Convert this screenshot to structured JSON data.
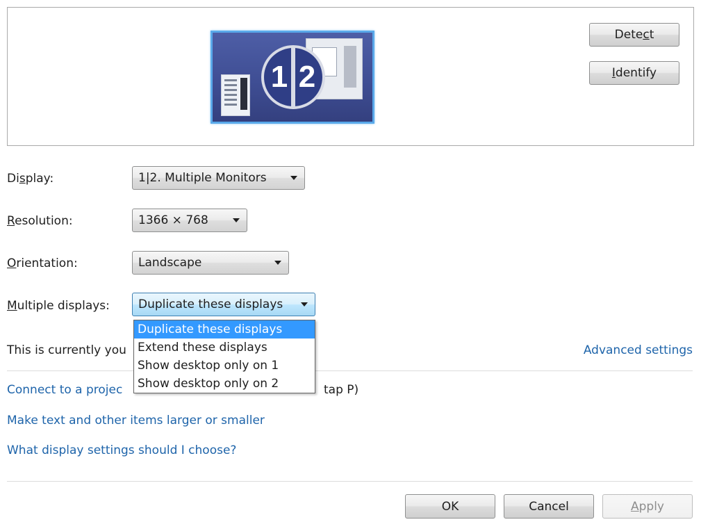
{
  "preview": {
    "badge_left": "1",
    "badge_right": "2"
  },
  "buttons": {
    "detect": {
      "pre": "Dete",
      "accel": "c",
      "post": "t"
    },
    "identify": {
      "pre": "",
      "accel": "I",
      "post": "dentify"
    },
    "ok": "OK",
    "cancel": "Cancel",
    "apply": {
      "pre": "",
      "accel": "A",
      "post": "pply"
    }
  },
  "display": {
    "label": {
      "pre": "Di",
      "accel": "s",
      "post": "play:"
    },
    "value": "1|2. Multiple Monitors"
  },
  "resolution": {
    "label": {
      "pre": "",
      "accel": "R",
      "post": "esolution:"
    },
    "value": "1366 × 768"
  },
  "orientation": {
    "label": {
      "pre": "",
      "accel": "O",
      "post": "rientation:"
    },
    "value": "Landscape"
  },
  "multiple_displays": {
    "label": {
      "pre": "",
      "accel": "M",
      "post": "ultiple displays:"
    },
    "value": "Duplicate these displays",
    "options": [
      "Duplicate these displays",
      "Extend these displays",
      "Show desktop only on 1",
      "Show desktop only on 2"
    ]
  },
  "status": {
    "text": "This is currently you"
  },
  "links": {
    "advanced_settings": "Advanced settings",
    "connect_projector_left": "Connect to a projec",
    "connect_projector_right": "tap P)",
    "text_size": "Make text and other items larger or smaller",
    "help": "What display settings should I choose?"
  }
}
